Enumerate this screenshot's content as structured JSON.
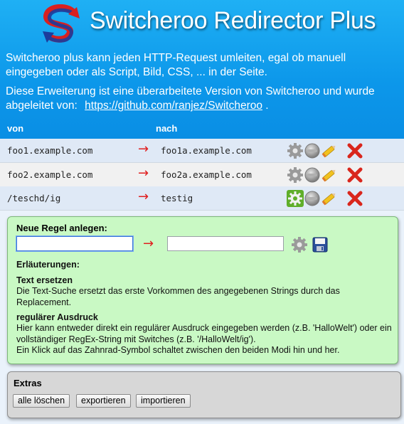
{
  "header": {
    "title": "Switcheroo Redirector Plus",
    "description_1": "Switcheroo plus kann jeden HTTP-Request umleiten, egal ob manuell eingegeben oder als Script, Bild, CSS, ... in der Seite.",
    "description_2": "Diese Erweiterung ist eine überarbeitete Version von Switcheroo und wurde abgeleitet von:",
    "source_link": "https://github.com/ranjez/Switcheroo",
    "source_suffix": " .",
    "col_from": "von",
    "col_to": "nach"
  },
  "rules": [
    {
      "from": "foo1.example.com",
      "to": "foo1a.example.com",
      "regex": false
    },
    {
      "from": "foo2.example.com",
      "to": "foo2a.example.com",
      "regex": false
    },
    {
      "from": "/teschd/ig",
      "to": "testig",
      "regex": true
    }
  ],
  "arrow": "→",
  "new_rule": {
    "heading": "Neue Regel anlegen:",
    "from_value": "",
    "to_value": "",
    "explanations_heading": "Erläuterungen:",
    "text_heading": "Text ersetzen",
    "text_body": "Die Text-Suche ersetzt das erste Vorkommen des angegebenen Strings durch das Replacement.",
    "regex_heading": "regulärer Ausdruck",
    "regex_body_1": "Hier kann entweder direkt ein regulärer Ausdruck eingegeben werden (z.B. 'HalloWelt') oder ein vollständiger RegEx-String mit Switches (z.B. '/HalloWelt/ig').",
    "regex_body_2": "Ein Klick auf das Zahnrad-Symbol schaltet zwischen den beiden Modi hin und her."
  },
  "extras": {
    "heading": "Extras",
    "delete_all": "alle löschen",
    "export": "exportieren",
    "import": "importieren"
  },
  "colors": {
    "header_blue": "#0c97ea",
    "new_rule_green": "#c9f9c4",
    "arrow_red": "#e02020",
    "delete_red": "#d9261c",
    "regex_gear_green": "#5fae2a"
  },
  "icons": {
    "logo": "switcheroo-s-logo",
    "mode": "gear-icon",
    "toggle": "toggle-off-icon",
    "edit": "pencil-icon",
    "delete": "delete-x-icon",
    "save": "floppy-save-icon"
  }
}
